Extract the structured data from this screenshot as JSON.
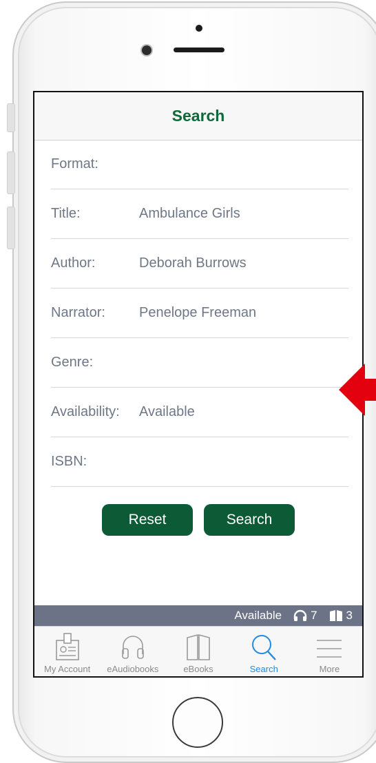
{
  "screen": {
    "title": "Search",
    "fields": [
      {
        "label": "Format:",
        "value": ""
      },
      {
        "label": "Title:",
        "value": "Ambulance Girls"
      },
      {
        "label": "Author:",
        "value": "Deborah Burrows"
      },
      {
        "label": "Narrator:",
        "value": "Penelope Freeman"
      },
      {
        "label": "Genre:",
        "value": ""
      },
      {
        "label": "Availability:",
        "value": "Available"
      },
      {
        "label": "ISBN:",
        "value": ""
      }
    ],
    "buttons": {
      "reset": "Reset",
      "search": "Search"
    },
    "status": {
      "label": "Available",
      "audio_count": "7",
      "ebook_count": "3"
    },
    "tabs": [
      {
        "label": "My Account",
        "icon": "account-card-icon"
      },
      {
        "label": "eAudiobooks",
        "icon": "headphones-icon"
      },
      {
        "label": "eBooks",
        "icon": "open-book-icon"
      },
      {
        "label": "Search",
        "icon": "search-icon",
        "active": true
      },
      {
        "label": "More",
        "icon": "menu-icon"
      }
    ]
  },
  "colors": {
    "accent": "#0f6a3a",
    "button": "#0d5a37",
    "status_bar": "#6c7387",
    "tab_active": "#1f8ae4",
    "arrow": "#e3000f"
  }
}
